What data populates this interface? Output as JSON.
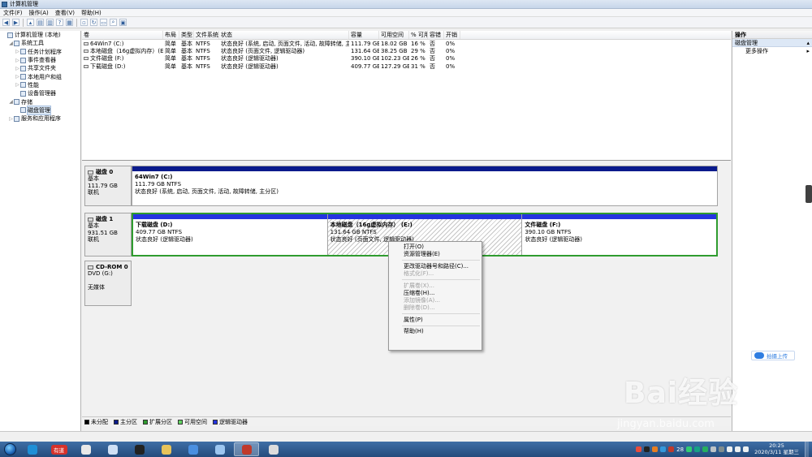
{
  "window": {
    "title": "计算机管理"
  },
  "menubar": [
    "文件(F)",
    "操作(A)",
    "查看(V)",
    "帮助(H)"
  ],
  "tree": [
    {
      "label": "计算机管理 (本地)",
      "indent": 0,
      "twisty": "",
      "icon": "computer-icon"
    },
    {
      "label": "系统工具",
      "indent": 1,
      "twisty": "◢",
      "icon": "tools-icon"
    },
    {
      "label": "任务计划程序",
      "indent": 2,
      "twisty": "▷",
      "icon": "clock-icon"
    },
    {
      "label": "事件查看器",
      "indent": 2,
      "twisty": "▷",
      "icon": "event-icon"
    },
    {
      "label": "共享文件夹",
      "indent": 2,
      "twisty": "▷",
      "icon": "folder-icon"
    },
    {
      "label": "本地用户和组",
      "indent": 2,
      "twisty": "▷",
      "icon": "users-icon"
    },
    {
      "label": "性能",
      "indent": 2,
      "twisty": "▷",
      "icon": "performance-icon"
    },
    {
      "label": "设备管理器",
      "indent": 2,
      "twisty": "",
      "icon": "device-icon"
    },
    {
      "label": "存储",
      "indent": 1,
      "twisty": "◢",
      "icon": "storage-icon"
    },
    {
      "label": "磁盘管理",
      "indent": 2,
      "twisty": "",
      "icon": "disk-icon",
      "selected": true
    },
    {
      "label": "服务和应用程序",
      "indent": 1,
      "twisty": "▷",
      "icon": "services-icon"
    }
  ],
  "volume_columns": [
    "卷",
    "布局",
    "类型",
    "文件系统",
    "状态",
    "容量",
    "可用空间",
    "% 可用",
    "容错",
    "开销"
  ],
  "volumes": [
    [
      "64Win7 (C:)",
      "简单",
      "基本",
      "NTFS",
      "状态良好 (系统, 启动, 页面文件, 活动, 故障转储, 主分区)",
      "111.79 GB",
      "18.02 GB",
      "16 %",
      "否",
      "0%"
    ],
    [
      "本地磁盘（16g虚拟内存）(E:)",
      "简单",
      "基本",
      "NTFS",
      "状态良好 (页面文件, 逻辑驱动器)",
      "131.64 GB",
      "38.25 GB",
      "29 %",
      "否",
      "0%"
    ],
    [
      "文件磁盘 (F:)",
      "简单",
      "基本",
      "NTFS",
      "状态良好 (逻辑驱动器)",
      "390.10 GB",
      "102.23 GB",
      "26 %",
      "否",
      "0%"
    ],
    [
      "下载磁盘 (D:)",
      "简单",
      "基本",
      "NTFS",
      "状态良好 (逻辑驱动器)",
      "409.77 GB",
      "127.29 GB",
      "31 %",
      "否",
      "0%"
    ]
  ],
  "disks": [
    {
      "name": "磁盘 0",
      "type": "基本",
      "size": "111.79 GB",
      "state": "联机",
      "partitions": [
        {
          "name": "64Win7   (C:)",
          "size": "111.79 GB NTFS",
          "status": "状态良好 (系统, 启动, 页面文件, 活动, 故障转储, 主分区)"
        }
      ]
    },
    {
      "name": "磁盘 1",
      "type": "基本",
      "size": "931.51 GB",
      "state": "联机",
      "partitions": [
        {
          "name": "下载磁盘  (D:)",
          "size": "409.77 GB NTFS",
          "status": "状态良好 (逻辑驱动器)"
        },
        {
          "name": "本地磁盘（16g虚拟内存） (E:)",
          "size": "131.64 GB NTFS",
          "status": "状态良好 (页面文件, 逻辑驱动器)"
        },
        {
          "name": "文件磁盘  (F:)",
          "size": "390.10 GB NTFS",
          "status": "状态良好 (逻辑驱动器)"
        }
      ]
    },
    {
      "name": "CD-ROM 0",
      "type": "DVD (G:)",
      "size": "",
      "state": "无媒体",
      "partitions": []
    }
  ],
  "legend": [
    {
      "label": "未分配",
      "color": "#000000"
    },
    {
      "label": "主分区",
      "color": "#0a1a8c"
    },
    {
      "label": "扩展分区",
      "color": "#2e9b2e"
    },
    {
      "label": "可用空间",
      "color": "#63d463"
    },
    {
      "label": "逻辑驱动器",
      "color": "#2434e0"
    }
  ],
  "actions": {
    "header": "操作",
    "section": "磁盘管理",
    "item": "更多操作"
  },
  "context_menu": [
    {
      "label": "打开(O)",
      "disabled": false
    },
    {
      "label": "资源管理器(E)",
      "disabled": false
    },
    {
      "sep": true
    },
    {
      "label": "更改驱动器号和路径(C)...",
      "disabled": false
    },
    {
      "label": "格式化(F)...",
      "disabled": true
    },
    {
      "sep": true
    },
    {
      "label": "扩展卷(X)...",
      "disabled": true
    },
    {
      "label": "压缩卷(H)...",
      "disabled": false
    },
    {
      "label": "添加镜像(A)...",
      "disabled": true
    },
    {
      "label": "删除卷(D)...",
      "disabled": true
    },
    {
      "sep": true
    },
    {
      "label": "属性(P)",
      "disabled": false
    },
    {
      "sep": true
    },
    {
      "label": "帮助(H)",
      "disabled": false
    }
  ],
  "cloud_button": "拍摄上传",
  "watermark": {
    "brand": "Bai经验",
    "url": "jingyan.baidu.com"
  },
  "taskbar": {
    "apps": [
      {
        "name": "edge-icon",
        "color": "#1f8fd6"
      },
      {
        "name": "app-red-icon",
        "color": "#d6322b",
        "text": "有道"
      },
      {
        "name": "app-circle-icon",
        "color": "#e8e8e8"
      },
      {
        "name": "notepad-icon",
        "color": "#cfe0f5"
      },
      {
        "name": "qq-icon",
        "color": "#222222"
      },
      {
        "name": "folder-icon",
        "color": "#e7c35a"
      },
      {
        "name": "shield-icon",
        "color": "#4a8fe0"
      },
      {
        "name": "cloud-icon",
        "color": "#9cc6f0"
      },
      {
        "name": "computer-management-icon",
        "color": "#c0392b",
        "active": true
      },
      {
        "name": "generic-app-icon",
        "color": "#dcdcdc"
      }
    ],
    "tray_badge": "28",
    "time": "20:25",
    "date": "2020/3/11 星期三"
  }
}
